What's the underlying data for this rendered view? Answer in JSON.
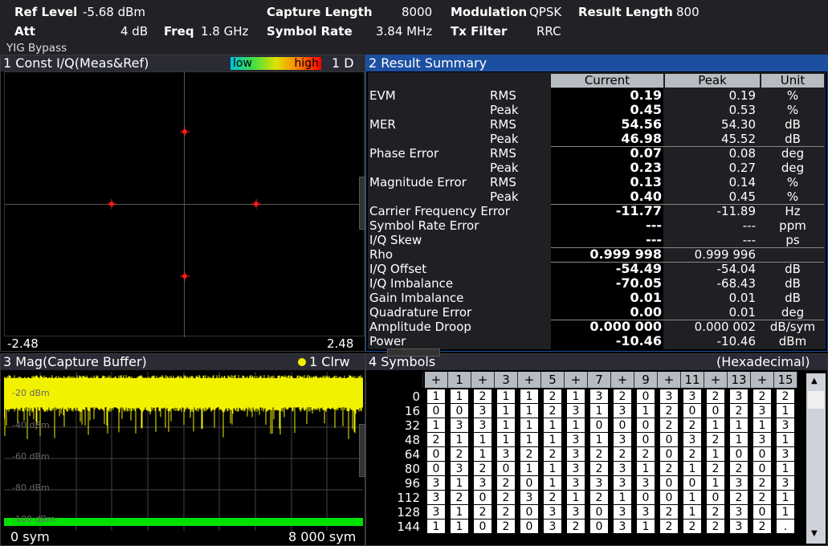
{
  "header": {
    "ref_level_label": "Ref Level",
    "ref_level_value": "-5.68 dBm",
    "att_label": "Att",
    "att_value": "4 dB",
    "freq_label": "Freq",
    "freq_value": "1.8 GHz",
    "yig": "YIG Bypass",
    "capture_length_label": "Capture Length",
    "capture_length_value": "8000",
    "symbol_rate_label": "Symbol Rate",
    "symbol_rate_value": "3.84 MHz",
    "modulation_label": "Modulation",
    "modulation_value": "QPSK",
    "txfilter_label": "Tx Filter",
    "txfilter_value": "RRC",
    "result_length_label": "Result Length",
    "result_length_value": "800"
  },
  "panel1": {
    "title": "1 Const I/Q(Meas&Ref)",
    "scale_low": "low",
    "scale_high": "high",
    "trace": "1 D",
    "x_min": "-2.48",
    "x_max": "2.48"
  },
  "panel2": {
    "title": "2 Result Summary",
    "col_current": "Current",
    "col_peak": "Peak",
    "col_unit": "Unit",
    "rows": [
      {
        "name": "EVM",
        "sub": "RMS",
        "current": "0.19",
        "peak": "0.19",
        "unit": "%"
      },
      {
        "name": "",
        "sub": "Peak",
        "current": "0.45",
        "peak": "0.53",
        "unit": "%"
      },
      {
        "name": "MER",
        "sub": "RMS",
        "current": "54.56",
        "peak": "54.30",
        "unit": "dB"
      },
      {
        "name": "",
        "sub": "Peak",
        "current": "46.98",
        "peak": "45.52",
        "unit": "dB"
      },
      {
        "name": "Phase Error",
        "sub": "RMS",
        "current": "0.07",
        "peak": "0.08",
        "unit": "deg"
      },
      {
        "name": "",
        "sub": "Peak",
        "current": "0.23",
        "peak": "0.27",
        "unit": "deg"
      },
      {
        "name": "Magnitude Error",
        "sub": "RMS",
        "current": "0.13",
        "peak": "0.14",
        "unit": "%"
      },
      {
        "name": "",
        "sub": "Peak",
        "current": "0.40",
        "peak": "0.45",
        "unit": "%"
      },
      {
        "name": "Carrier Frequency Error",
        "sub": "",
        "current": "-11.77",
        "peak": "-11.89",
        "unit": "Hz"
      },
      {
        "name": "Symbol Rate Error",
        "sub": "",
        "current": "---",
        "peak": "---",
        "unit": "ppm"
      },
      {
        "name": "I/Q Skew",
        "sub": "",
        "current": "---",
        "peak": "---",
        "unit": "ps"
      },
      {
        "name": "Rho",
        "sub": "",
        "current": "0.999 998",
        "peak": "0.999 996",
        "unit": ""
      },
      {
        "name": "I/Q Offset",
        "sub": "",
        "current": "-54.49",
        "peak": "-54.04",
        "unit": "dB"
      },
      {
        "name": "I/Q Imbalance",
        "sub": "",
        "current": "-70.05",
        "peak": "-68.43",
        "unit": "dB"
      },
      {
        "name": "Gain Imbalance",
        "sub": "",
        "current": "0.01",
        "peak": "0.01",
        "unit": "dB"
      },
      {
        "name": "Quadrature Error",
        "sub": "",
        "current": "0.00",
        "peak": "0.01",
        "unit": "deg"
      },
      {
        "name": "Amplitude Droop",
        "sub": "",
        "current": "0.000 000",
        "peak": "0.000 002",
        "unit": "dB/sym"
      },
      {
        "name": "Power",
        "sub": "",
        "current": "-10.46",
        "peak": "-10.46",
        "unit": "dBm"
      }
    ]
  },
  "panel3": {
    "title": "3 Mag(Capture Buffer)",
    "trace": "1 Clrw",
    "y_labels": [
      "-20 dBm",
      "-40 dBm",
      "-60 dBm",
      "-80 dBm",
      "-100 dBm"
    ],
    "x_min": "0 sym",
    "x_max": "8 000 sym"
  },
  "panel4": {
    "title": "4 Symbols",
    "format": "(Hexadecimal)",
    "col_headers": [
      "+",
      "1",
      "+",
      "3",
      "+",
      "5",
      "+",
      "7",
      "+",
      "9",
      "+",
      "11",
      "+",
      "13",
      "+",
      "15"
    ],
    "row_labels": [
      "0",
      "16",
      "32",
      "48",
      "64",
      "80",
      "96",
      "112",
      "128",
      "144"
    ],
    "rows": [
      [
        "1",
        "1",
        "2",
        "1",
        "1",
        "2",
        "1",
        "3",
        "2",
        "0",
        "3",
        "3",
        "2",
        "3",
        "2",
        "2"
      ],
      [
        "0",
        "0",
        "3",
        "1",
        "1",
        "2",
        "3",
        "1",
        "3",
        "1",
        "2",
        "0",
        "0",
        "2",
        "3",
        "1"
      ],
      [
        "1",
        "3",
        "3",
        "1",
        "1",
        "1",
        "1",
        "0",
        "0",
        "0",
        "2",
        "2",
        "1",
        "1",
        "1",
        "3"
      ],
      [
        "2",
        "1",
        "1",
        "1",
        "1",
        "1",
        "3",
        "1",
        "3",
        "0",
        "0",
        "3",
        "2",
        "1",
        "3",
        "1"
      ],
      [
        "0",
        "2",
        "1",
        "3",
        "2",
        "2",
        "3",
        "2",
        "2",
        "2",
        "0",
        "2",
        "1",
        "0",
        "0",
        "3"
      ],
      [
        "0",
        "3",
        "2",
        "0",
        "1",
        "1",
        "3",
        "2",
        "3",
        "1",
        "2",
        "1",
        "2",
        "2",
        "0",
        "1"
      ],
      [
        "3",
        "1",
        "3",
        "2",
        "0",
        "1",
        "3",
        "3",
        "3",
        "3",
        "0",
        "0",
        "1",
        "3",
        "2",
        "3"
      ],
      [
        "3",
        "2",
        "0",
        "2",
        "3",
        "2",
        "1",
        "2",
        "1",
        "0",
        "0",
        "1",
        "0",
        "2",
        "2",
        "1"
      ],
      [
        "3",
        "1",
        "2",
        "2",
        "0",
        "3",
        "3",
        "0",
        "3",
        "3",
        "2",
        "1",
        "2",
        "3",
        "0",
        "1"
      ],
      [
        "1",
        "1",
        "0",
        "2",
        "0",
        "3",
        "2",
        "0",
        "3",
        "1",
        "2",
        "2",
        "2",
        "3",
        "2",
        "."
      ]
    ]
  },
  "colors": {
    "title_active": "#1c4fa0",
    "trace_yellow": "#f2f200",
    "marker_red": "#ff1a1a",
    "limit_green": "#00e000"
  }
}
